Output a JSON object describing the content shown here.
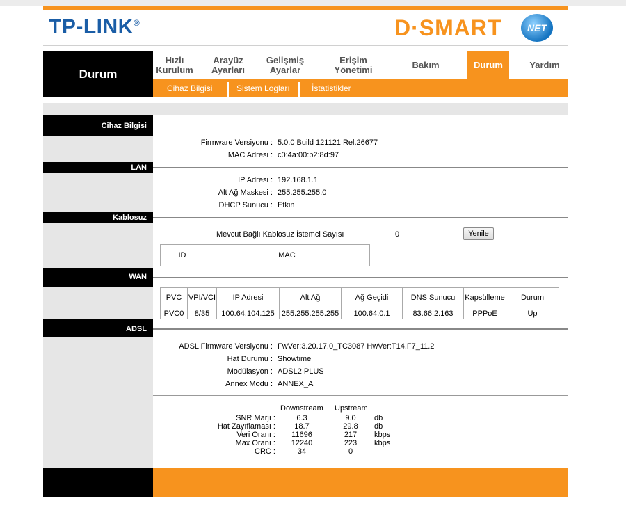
{
  "brand": {
    "tp_link": "TP-LINK",
    "reg": "®",
    "dsmart": "D·SMART",
    "net": "NET"
  },
  "nav": {
    "current_section": "Durum",
    "items": [
      {
        "label": "Hızlı\nKurulum"
      },
      {
        "label": "Arayüz\nAyarları"
      },
      {
        "label": "Gelişmiş\nAyarlar"
      },
      {
        "label": "Erişim\nYönetimi"
      },
      {
        "label": "Bakım"
      },
      {
        "label": "Durum"
      },
      {
        "label": "Yardım"
      }
    ],
    "sub": [
      "Cihaz Bilgisi",
      "Sistem Logları",
      "İstatistikler"
    ]
  },
  "sections": {
    "device": "Cihaz Bilgisi",
    "lan": "LAN",
    "wireless": "Kablosuz",
    "wan": "WAN",
    "adsl": "ADSL"
  },
  "device": {
    "firmware_label": "Firmware Versiyonu :",
    "firmware_value": "5.0.0 Build 121121 Rel.26677",
    "mac_label": "MAC Adresi :",
    "mac_value": "c0:4a:00:b2:8d:97"
  },
  "lan": {
    "ip_label": "IP Adresi :",
    "ip_value": "192.168.1.1",
    "mask_label": "Alt Ağ Maskesi :",
    "mask_value": "255.255.255.0",
    "dhcp_label": "DHCP Sunucu :",
    "dhcp_value": "Etkin"
  },
  "wireless": {
    "clients_label": "Mevcut Bağlı Kablosuz İstemci Sayısı",
    "clients_value": "0",
    "refresh_button": "Yenile",
    "table_headers": [
      "ID",
      "MAC"
    ]
  },
  "wan": {
    "headers": [
      "PVC",
      "VPI/VCI",
      "IP Adresi",
      "Alt Ağ",
      "Ağ Geçidi",
      "DNS Sunucu",
      "Kapsülleme",
      "Durum"
    ],
    "rows": [
      [
        "PVC0",
        "8/35",
        "100.64.104.125",
        "255.255.255.255",
        "100.64.0.1",
        "83.66.2.163",
        "PPPoE",
        "Up"
      ]
    ]
  },
  "adsl": {
    "fw_label": "ADSL Firmware Versiyonu :",
    "fw_value": "FwVer:3.20.17.0_TC3087 HwVer:T14.F7_11.2",
    "line_label": "Hat Durumu :",
    "line_value": "Showtime",
    "mod_label": "Modülasyon :",
    "mod_value": "ADSL2 PLUS",
    "annex_label": "Annex Modu :",
    "annex_value": "ANNEX_A",
    "stats_headers": {
      "down": "Downstream",
      "up": "Upstream"
    },
    "stats": [
      {
        "label": "SNR Marjı :",
        "down": "6.3",
        "up": "9.0",
        "unit": "db"
      },
      {
        "label": "Hat Zayıflaması :",
        "down": "18.7",
        "up": "29.8",
        "unit": "db"
      },
      {
        "label": "Veri Oranı :",
        "down": "11696",
        "up": "217",
        "unit": "kbps"
      },
      {
        "label": "Max Oranı :",
        "down": "12240",
        "up": "223",
        "unit": "kbps"
      },
      {
        "label": "CRC :",
        "down": "34",
        "up": "0",
        "unit": ""
      }
    ]
  },
  "colors": {
    "accent": "#f7931e",
    "brand_blue": "#1a5da6",
    "dark": "#000000",
    "panel": "#e6e6e6"
  }
}
